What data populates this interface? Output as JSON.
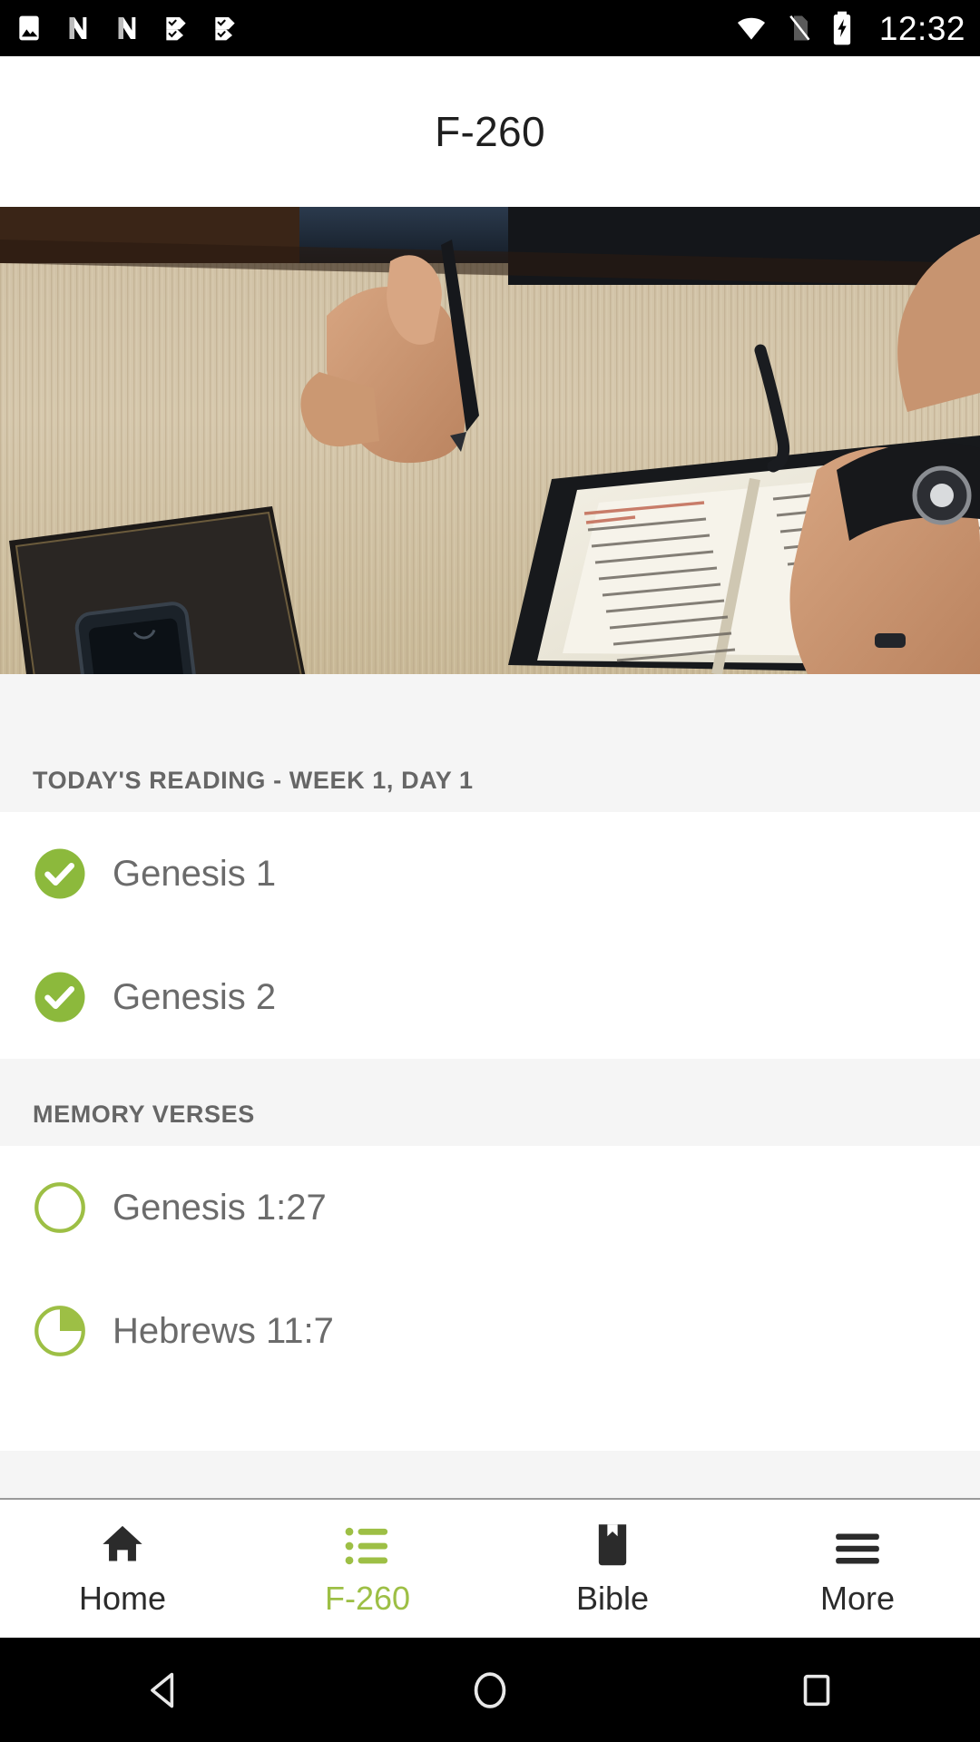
{
  "status_bar": {
    "clock": "12:32",
    "left_icons": [
      "image-gallery-icon",
      "app-notification-n-icon",
      "app-notification-n-icon",
      "app-notification-check-icon",
      "app-notification-check-icon"
    ],
    "right_icons": [
      "wifi-icon",
      "sim-card-off-icon",
      "battery-charging-icon"
    ]
  },
  "app_bar": {
    "title": "F-260"
  },
  "hero": {
    "alt": "Open Bible, leather journal, smartphone and pen on a wooden desk with hands"
  },
  "sections": [
    {
      "header": "TODAY'S READING - WEEK 1, DAY 1",
      "items": [
        {
          "label": "Genesis 1",
          "state": "complete",
          "progress": 100
        },
        {
          "label": "Genesis 2",
          "state": "complete",
          "progress": 100
        }
      ]
    },
    {
      "header": "MEMORY VERSES",
      "items": [
        {
          "label": "Genesis 1:27",
          "state": "empty",
          "progress": 0
        },
        {
          "label": "Hebrews 11:7",
          "state": "partial",
          "progress": 25
        }
      ]
    }
  ],
  "bottom_nav": {
    "tabs": [
      {
        "label": "Home",
        "icon": "home-icon",
        "active": false
      },
      {
        "label": "F-260",
        "icon": "list-icon",
        "active": true
      },
      {
        "label": "Bible",
        "icon": "bookmark-icon",
        "active": false
      },
      {
        "label": "More",
        "icon": "hamburger-icon",
        "active": false
      }
    ]
  },
  "android_nav": {
    "buttons": [
      "back-icon",
      "home-circle-icon",
      "recents-square-icon"
    ]
  },
  "colors": {
    "accent_green": "#9dbf45",
    "check_green": "#8cb93c",
    "text_primary": "#1f1f1f",
    "text_secondary": "#6b6b6b",
    "section_header": "#666666",
    "surface": "#ffffff",
    "background": "#f5f5f5",
    "status_bar": "#000000"
  }
}
